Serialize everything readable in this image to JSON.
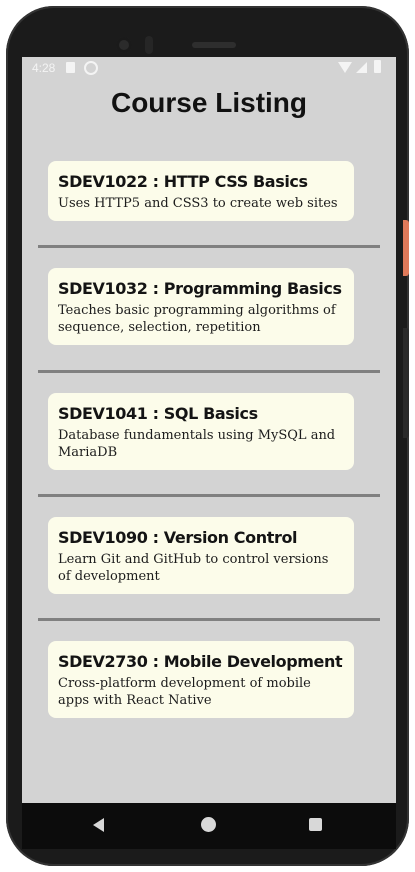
{
  "status_bar": {
    "time": "4:28",
    "icons": [
      "sim-card-icon",
      "sync-icon",
      "wifi-icon",
      "signal-icon",
      "battery-icon"
    ]
  },
  "page": {
    "title": "Course Listing"
  },
  "courses": [
    {
      "title": "SDEV1022 : HTTP CSS Basics",
      "description": "Uses HTTP5 and CSS3 to create web sites"
    },
    {
      "title": "SDEV1032 : Programming Basics",
      "description": "Teaches basic programming algorithms of sequence, selection, repetition"
    },
    {
      "title": "SDEV1041 : SQL Basics",
      "description": "Database fundamentals using MySQL and MariaDB"
    },
    {
      "title": "SDEV1090 : Version Control",
      "description": "Learn Git and GitHub to control versions of development"
    },
    {
      "title": "SDEV2730 : Mobile Development",
      "description": "Cross-platform development of mobile apps with React Native"
    }
  ],
  "nav_bar": {
    "icons": [
      "back-icon",
      "home-icon",
      "recent-apps-icon"
    ]
  },
  "colors": {
    "screen_background": "#d3d3d3",
    "card_background": "#fcfcea",
    "divider": "#808080",
    "text": "#141414"
  }
}
